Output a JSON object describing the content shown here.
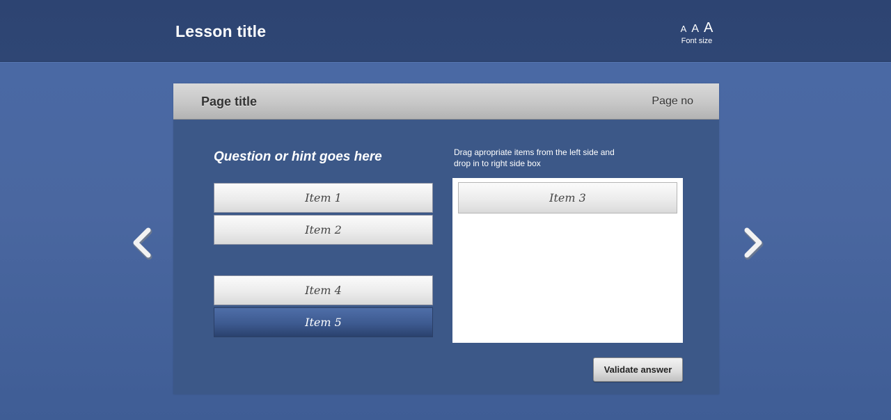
{
  "header": {
    "lesson_title": "Lesson title",
    "font_size": {
      "label": "Font size",
      "small": "A",
      "medium": "A",
      "large": "A"
    }
  },
  "panel": {
    "page_title": "Page title",
    "page_no": "Page no",
    "question": "Question or hint goes here",
    "instructions": "Drag apropriate items from the left side and drop in to right side box",
    "left_items": [
      "Item 1",
      "Item 2",
      "Item 4",
      "Item 5"
    ],
    "active_item": "Item 5",
    "dropped_items": [
      "Item 3"
    ],
    "validate_label": "Validate answer"
  },
  "navigation": {
    "prev_icon": "chevron-left-icon",
    "next_icon": "chevron-right-icon"
  },
  "colors": {
    "background": "#4a67a0",
    "topbar": "#2e4573",
    "panel": "#3c5888",
    "active_item": "#3d5a90"
  }
}
